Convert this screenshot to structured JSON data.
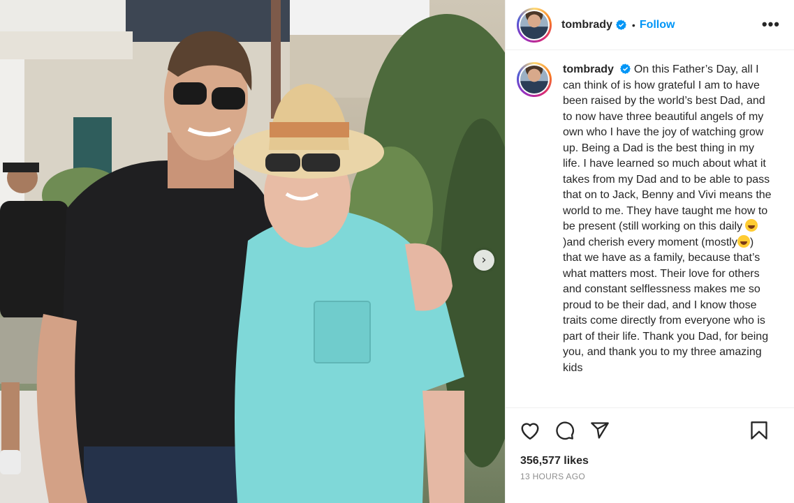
{
  "photo": {
    "alt_description": "",
    "next_icon": "chevron-right-icon"
  },
  "header": {
    "username": "tombrady",
    "separator": "•",
    "follow_label": "Follow",
    "more_icon": "more-horizontal-icon",
    "more_label": "•••"
  },
  "caption": {
    "username": "tombrady",
    "part1": "On this Father’s Day, all I can think of is how grateful I am to have been raised by the world’s best Dad, and to now have three beautiful angels of my own who I have the joy of watching grow up. Being a Dad is the best thing in my life. I have learned so much about what it takes from my Dad and to be able to pass that on to Jack, Benny and Vivi means the world to me. They have taught me how to be present (still working on this daily ",
    "part2": ")and cherish every moment (mostly",
    "part3": ") that we have as a family, because that’s what matters most. Their love for others and constant selflessness makes me so proud to be their dad, and I know those traits come directly from everyone who is part of their life. Thank you Dad, for being you, and thank you to my three amazing kids"
  },
  "actions": {
    "like_icon": "heart-icon",
    "comment_icon": "comment-icon",
    "share_icon": "share-icon",
    "save_icon": "bookmark-icon"
  },
  "likes": "356,577 likes",
  "timestamp": "13 HOURS AGO",
  "colors": {
    "accent": "#0095f6",
    "text": "#262626",
    "muted": "#8e8e8e",
    "border": "#efefef"
  }
}
